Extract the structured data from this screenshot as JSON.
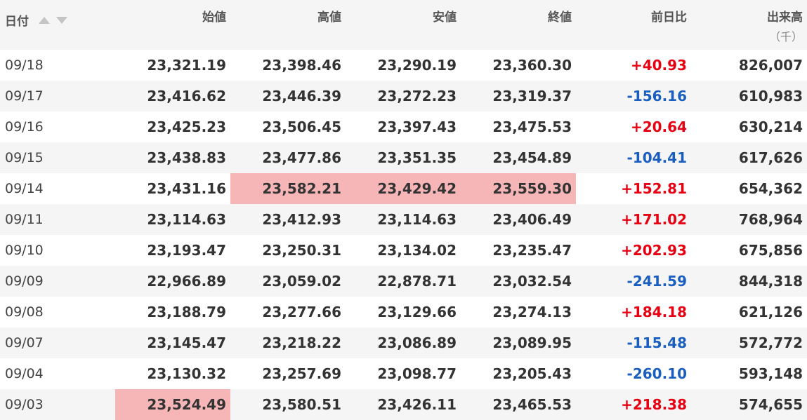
{
  "header": {
    "date": "日付",
    "open": "始値",
    "high": "高値",
    "low": "安値",
    "close": "終値",
    "change": "前日比",
    "volume": "出来高",
    "volume_unit": "（千）"
  },
  "colors": {
    "positive": "#e60012",
    "negative": "#1a5fbf",
    "highlight": "#f6b6b7",
    "stripe": "#f5f5f5"
  },
  "rows": [
    {
      "date": "09/18",
      "open": "23,321.19",
      "high": "23,398.46",
      "low": "23,290.19",
      "close": "23,360.30",
      "change": "+40.93",
      "volume": "826,007"
    },
    {
      "date": "09/17",
      "open": "23,416.62",
      "high": "23,446.39",
      "low": "23,272.23",
      "close": "23,319.37",
      "change": "-156.16",
      "volume": "610,983"
    },
    {
      "date": "09/16",
      "open": "23,425.23",
      "high": "23,506.45",
      "low": "23,397.43",
      "close": "23,475.53",
      "change": "+20.64",
      "volume": "630,214"
    },
    {
      "date": "09/15",
      "open": "23,438.83",
      "high": "23,477.86",
      "low": "23,351.35",
      "close": "23,454.89",
      "change": "-104.41",
      "volume": "617,626"
    },
    {
      "date": "09/14",
      "open": "23,431.16",
      "high": "23,582.21",
      "low": "23,429.42",
      "close": "23,559.30",
      "change": "+152.81",
      "volume": "654,362"
    },
    {
      "date": "09/11",
      "open": "23,114.63",
      "high": "23,412.93",
      "low": "23,114.63",
      "close": "23,406.49",
      "change": "+171.02",
      "volume": "768,964"
    },
    {
      "date": "09/10",
      "open": "23,193.47",
      "high": "23,250.31",
      "low": "23,134.02",
      "close": "23,235.47",
      "change": "+202.93",
      "volume": "675,856"
    },
    {
      "date": "09/09",
      "open": "22,966.89",
      "high": "23,059.02",
      "low": "22,878.71",
      "close": "23,032.54",
      "change": "-241.59",
      "volume": "844,318"
    },
    {
      "date": "09/08",
      "open": "23,188.79",
      "high": "23,277.66",
      "low": "23,129.66",
      "close": "23,274.13",
      "change": "+184.18",
      "volume": "621,126"
    },
    {
      "date": "09/07",
      "open": "23,145.47",
      "high": "23,218.22",
      "low": "23,086.89",
      "close": "23,089.95",
      "change": "-115.48",
      "volume": "572,772"
    },
    {
      "date": "09/04",
      "open": "23,130.32",
      "high": "23,257.69",
      "low": "23,098.77",
      "close": "23,205.43",
      "change": "-260.10",
      "volume": "593,148"
    },
    {
      "date": "09/03",
      "open": "23,524.49",
      "high": "23,580.51",
      "low": "23,426.11",
      "close": "23,465.53",
      "change": "+218.38",
      "volume": "574,655"
    }
  ]
}
